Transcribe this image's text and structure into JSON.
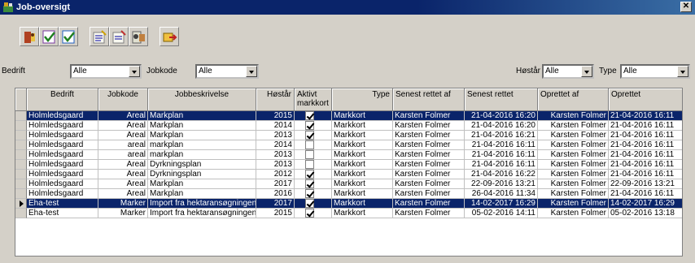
{
  "window": {
    "title": "Job-oversigt",
    "close_label": "✕"
  },
  "toolbar": {
    "buttons": [
      "run-job-icon",
      "check-icon",
      "check-all-icon",
      "edit-list-icon",
      "edit-new-icon",
      "import-icon",
      "exit-icon"
    ]
  },
  "filters": {
    "bedrift_label": "Bedrift",
    "bedrift_value": "Alle",
    "jobkode_label": "Jobkode",
    "jobkode_value": "Alle",
    "hoestaar_label": "Høstår",
    "hoestaar_value": "Alle",
    "type_label": "Type",
    "type_value": "Alle"
  },
  "grid": {
    "columns": [
      "Bedrift",
      "Jobkode",
      "Jobbeskrivelse",
      "Høstår",
      "Aktivt markkort",
      "Type",
      "Senest rettet af",
      "Senest rettet",
      "Oprettet af",
      "Oprettet"
    ],
    "rows": [
      {
        "bedrift": "Holmledsgaard",
        "jobkode": "Areal",
        "beskrivelse": "Markplan",
        "aar": "2015",
        "aktivt": true,
        "type": "Markkort",
        "rettet_af": "Karsten Folmer",
        "rettet": "21-04-2016 16:20",
        "oprettet_af": "Karsten Folmer",
        "oprettet": "21-04-2016 16:11",
        "selected": true,
        "current": false
      },
      {
        "bedrift": "Holmledsgaard",
        "jobkode": "Areal",
        "beskrivelse": "Markplan",
        "aar": "2014",
        "aktivt": true,
        "type": "Markkort",
        "rettet_af": "Karsten Folmer",
        "rettet": "21-04-2016 16:20",
        "oprettet_af": "Karsten Folmer",
        "oprettet": "21-04-2016 16:11",
        "selected": false,
        "current": false
      },
      {
        "bedrift": "Holmledsgaard",
        "jobkode": "Areal",
        "beskrivelse": "Markplan",
        "aar": "2013",
        "aktivt": true,
        "type": "Markkort",
        "rettet_af": "Karsten Folmer",
        "rettet": "21-04-2016 16:21",
        "oprettet_af": "Karsten Folmer",
        "oprettet": "21-04-2016 16:11",
        "selected": false,
        "current": false
      },
      {
        "bedrift": "Holmledsgaard",
        "jobkode": "areal",
        "beskrivelse": "markplan",
        "aar": "2014",
        "aktivt": false,
        "type": "Markkort",
        "rettet_af": "Karsten Folmer",
        "rettet": "21-04-2016 16:11",
        "oprettet_af": "Karsten Folmer",
        "oprettet": "21-04-2016 16:11",
        "selected": false,
        "current": false
      },
      {
        "bedrift": "Holmledsgaard",
        "jobkode": "areal",
        "beskrivelse": "markplan",
        "aar": "2013",
        "aktivt": false,
        "type": "Markkort",
        "rettet_af": "Karsten Folmer",
        "rettet": "21-04-2016 16:11",
        "oprettet_af": "Karsten Folmer",
        "oprettet": "21-04-2016 16:11",
        "selected": false,
        "current": false
      },
      {
        "bedrift": "Holmledsgaard",
        "jobkode": "Areal",
        "beskrivelse": "Dyrkningsplan",
        "aar": "2013",
        "aktivt": false,
        "type": "Markkort",
        "rettet_af": "Karsten Folmer",
        "rettet": "21-04-2016 16:11",
        "oprettet_af": "Karsten Folmer",
        "oprettet": "21-04-2016 16:11",
        "selected": false,
        "current": false
      },
      {
        "bedrift": "Holmledsgaard",
        "jobkode": "Areal",
        "beskrivelse": "Dyrkningsplan",
        "aar": "2012",
        "aktivt": true,
        "type": "Markkort",
        "rettet_af": "Karsten Folmer",
        "rettet": "21-04-2016 16:22",
        "oprettet_af": "Karsten Folmer",
        "oprettet": "21-04-2016 16:11",
        "selected": false,
        "current": false
      },
      {
        "bedrift": "Holmledsgaard",
        "jobkode": "Areal",
        "beskrivelse": "Markplan",
        "aar": "2017",
        "aktivt": true,
        "type": "Markkort",
        "rettet_af": "Karsten Folmer",
        "rettet": "22-09-2016 13:21",
        "oprettet_af": "Karsten Folmer",
        "oprettet": "22-09-2016 13:21",
        "selected": false,
        "current": false
      },
      {
        "bedrift": "Holmledsgaard",
        "jobkode": "Areal",
        "beskrivelse": "Markplan",
        "aar": "2016",
        "aktivt": true,
        "type": "Markkort",
        "rettet_af": "Karsten Folmer",
        "rettet": "26-04-2016 11:34",
        "oprettet_af": "Karsten Folmer",
        "oprettet": "21-04-2016 16:11",
        "selected": false,
        "current": false
      },
      {
        "bedrift": "Eha-test",
        "jobkode": "Marker",
        "beskrivelse": "Import fra hektaransøgningen",
        "aar": "2017",
        "aktivt": true,
        "type": "Markkort",
        "rettet_af": "Karsten Folmer",
        "rettet": "14-02-2017 16:29",
        "oprettet_af": "Karsten Folmer",
        "oprettet": "14-02-2017 16:29",
        "selected": true,
        "current": true
      },
      {
        "bedrift": "Eha-test",
        "jobkode": "Marker",
        "beskrivelse": "Import fra hektaransøgningen",
        "aar": "2015",
        "aktivt": true,
        "type": "Markkort",
        "rettet_af": "Karsten Folmer",
        "rettet": "05-02-2016 14:11",
        "oprettet_af": "Karsten Folmer",
        "oprettet": "05-02-2016 13:18",
        "selected": false,
        "current": false
      }
    ]
  }
}
